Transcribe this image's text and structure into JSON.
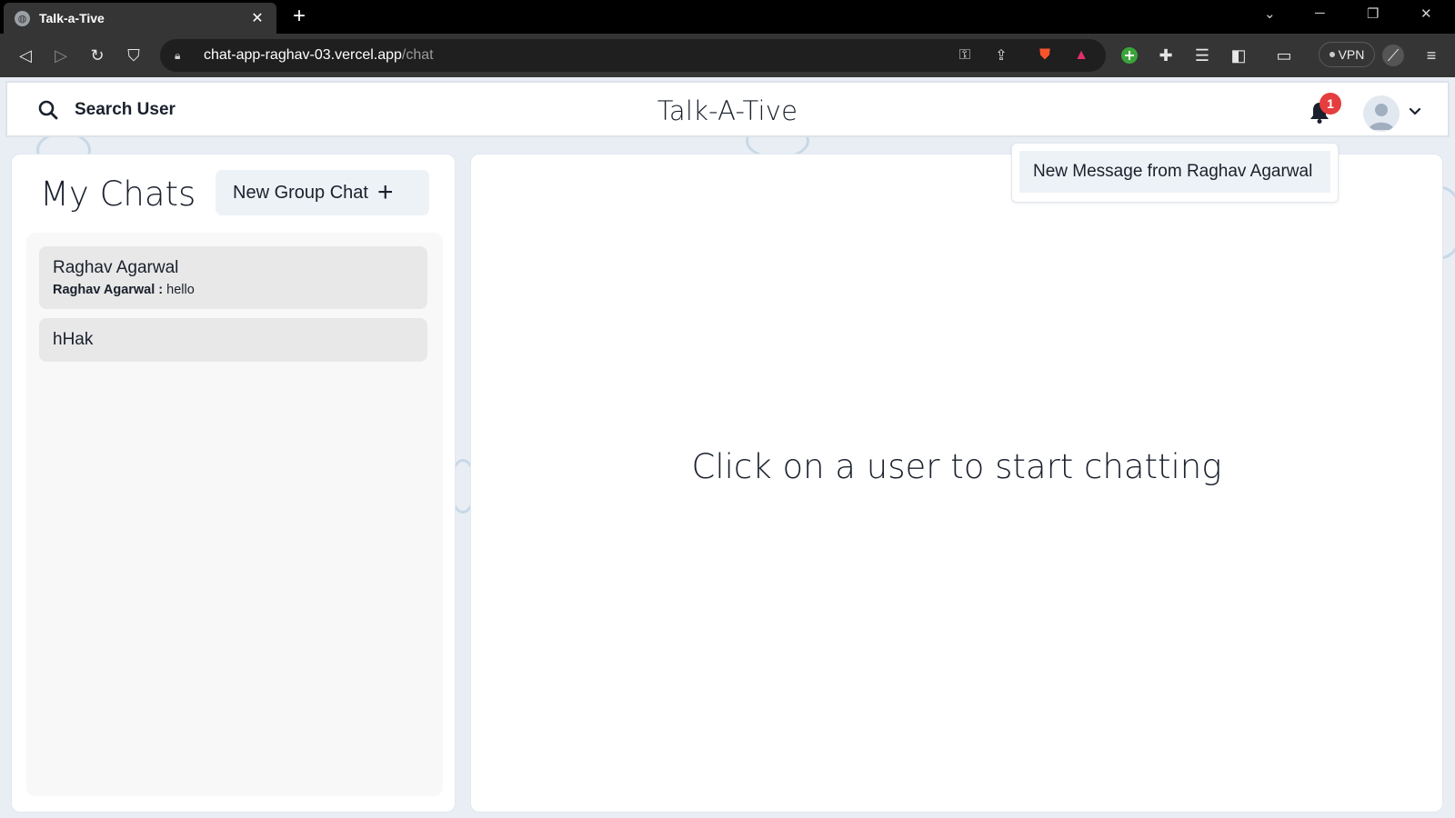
{
  "browser": {
    "tab_title": "Talk-a-Tive",
    "url_host": "chat-app-raghav-03.vercel.app",
    "url_path": "/chat",
    "vpn_label": "VPN"
  },
  "header": {
    "search_label": "Search User",
    "app_title": "Talk-A-Tive",
    "notification_count": "1"
  },
  "notifications": {
    "items": [
      {
        "text": "New Message from Raghav Agarwal"
      }
    ]
  },
  "sidebar": {
    "title": "My Chats",
    "new_group_label": "New Group Chat",
    "chats": [
      {
        "name": "Raghav Agarwal",
        "latest_sender": "Raghav Agarwal :",
        "latest_message": "hello"
      },
      {
        "name": "hHak"
      }
    ]
  },
  "chatbox": {
    "placeholder": "Click on a user to start chatting"
  },
  "colors": {
    "badge": "#e53e3e",
    "button_bg": "#edf2f7",
    "chat_item_bg": "#e8e8e8",
    "browser_toolbar": "#353535"
  }
}
